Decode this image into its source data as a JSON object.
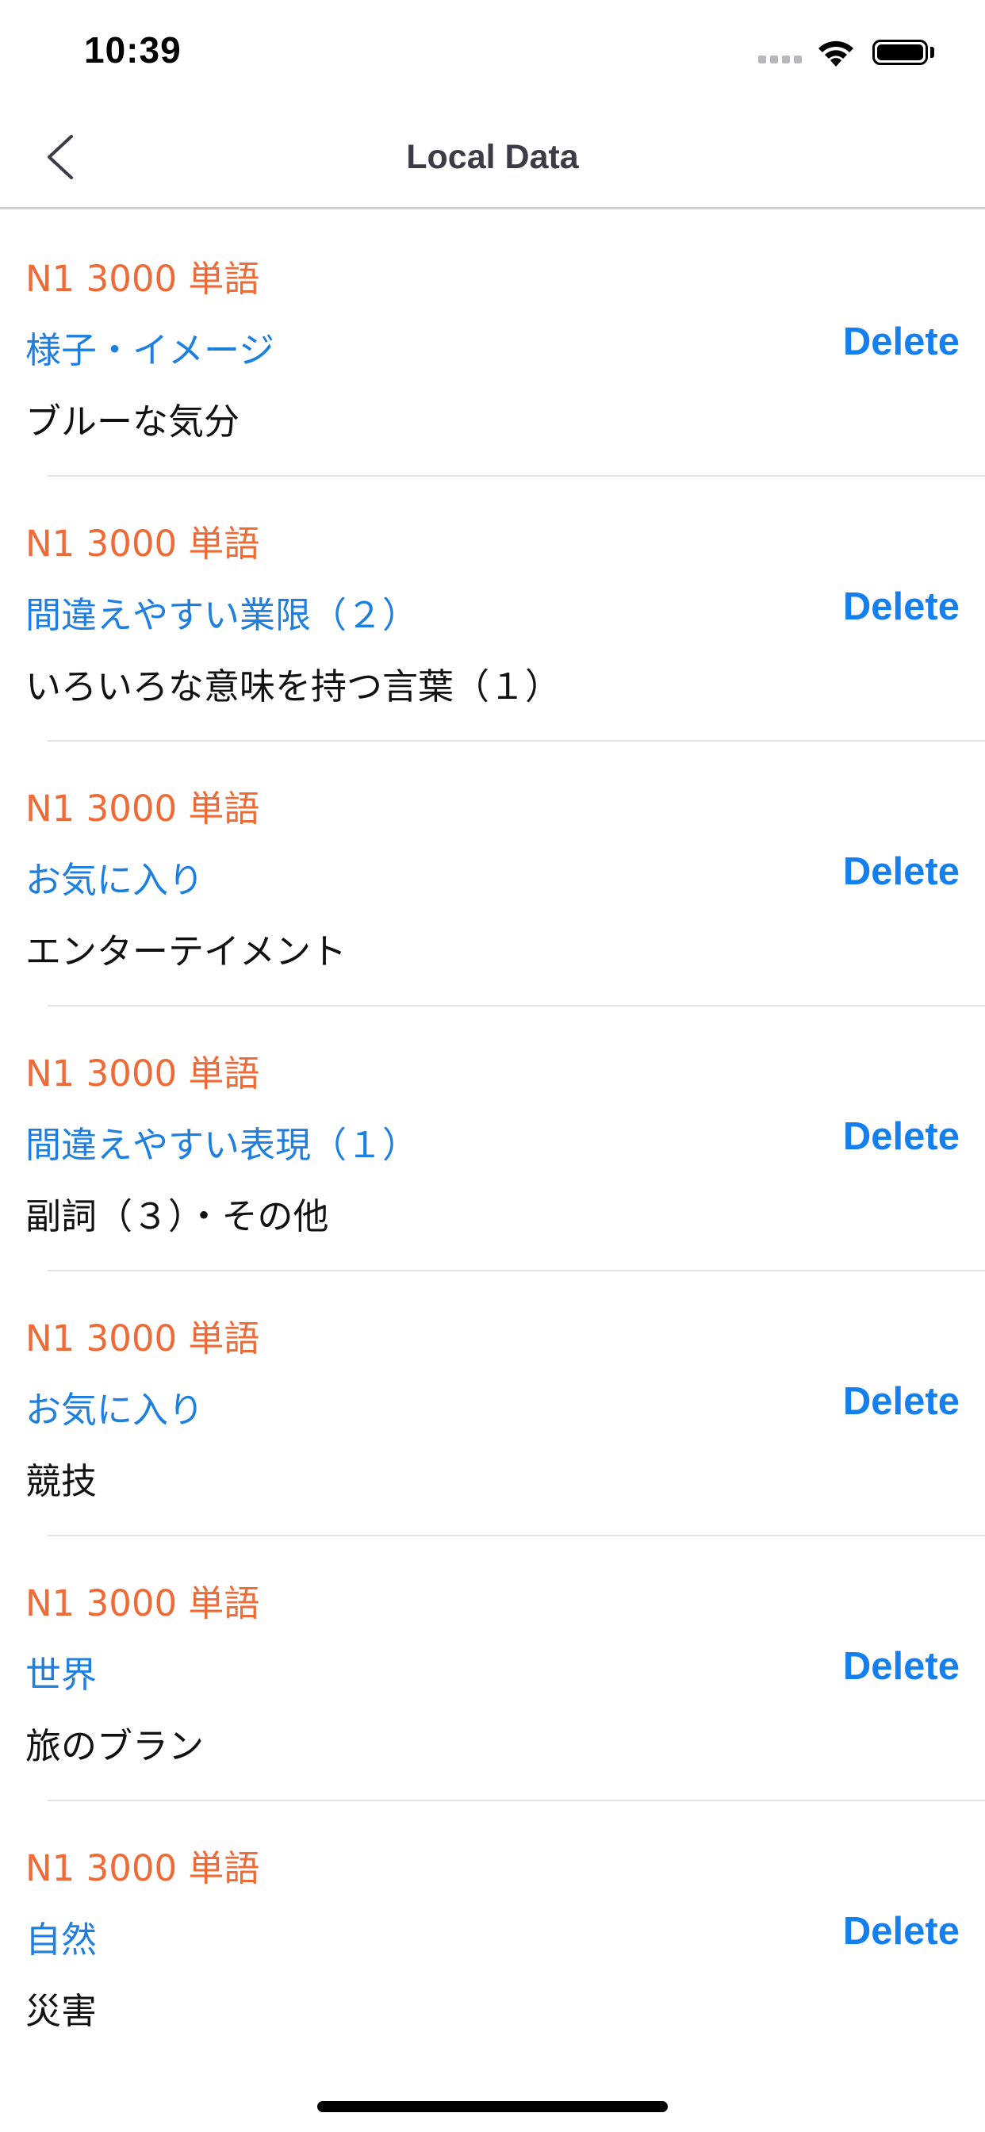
{
  "status_bar": {
    "time": "10:39"
  },
  "nav": {
    "title": "Local Data",
    "back_icon": "chevron-left-icon"
  },
  "rows": [
    {
      "book": "N1 3000 単語",
      "category": "様子・イメージ",
      "title": "ブルーな気分",
      "delete_label": "Delete"
    },
    {
      "book": "N1 3000 単語",
      "category": "間違えやすい業限（２）",
      "title": "いろいろな意味を持つ言葉（１）",
      "delete_label": "Delete"
    },
    {
      "book": "N1 3000 単語",
      "category": "お気に入り",
      "title": "エンターテイメント",
      "delete_label": "Delete"
    },
    {
      "book": "N1 3000 単語",
      "category": "間違えやすい表現（１）",
      "title": "副詞（３）・その他",
      "delete_label": "Delete"
    },
    {
      "book": "N1 3000 単語",
      "category": "お気に入り",
      "title": "競技",
      "delete_label": "Delete"
    },
    {
      "book": "N1 3000 単語",
      "category": "世界",
      "title": "旅のブラン",
      "delete_label": "Delete"
    },
    {
      "book": "N1 3000 単語",
      "category": "自然",
      "title": "災害",
      "delete_label": "Delete"
    }
  ],
  "colors": {
    "book": "#ee6a36",
    "category": "#1d7fe0",
    "delete": "#1480f0",
    "title": "#111111"
  }
}
